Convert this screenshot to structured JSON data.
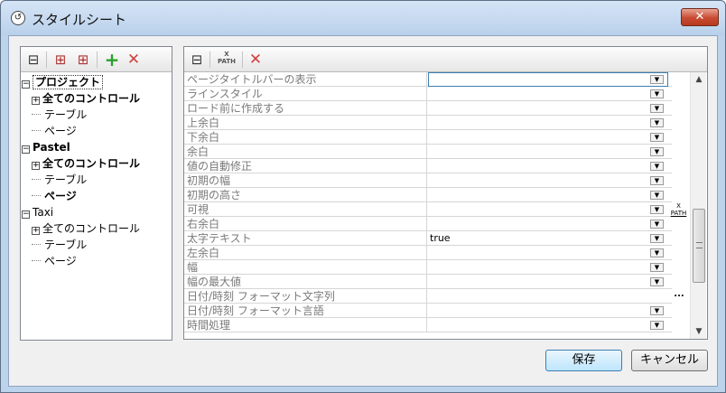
{
  "window": {
    "title": "スタイルシート",
    "close": "✕"
  },
  "left_toolbar": {
    "icons": [
      "tree-icon",
      "add-child-icon",
      "add-sibling-icon",
      "add-icon",
      "delete-icon"
    ],
    "glyphs": [
      "⊟",
      "⊞",
      "⊞",
      "+",
      "✕"
    ]
  },
  "tree": [
    {
      "label": "プロジェクト",
      "expander": "−",
      "bold": true,
      "level": 0,
      "selected": true
    },
    {
      "label": "全てのコントロール",
      "expander": "+",
      "bold": true,
      "level": 1
    },
    {
      "label": "テーブル",
      "level": 1
    },
    {
      "label": "ページ",
      "level": 1
    },
    {
      "label": "Pastel",
      "expander": "−",
      "bold": true,
      "level": 0
    },
    {
      "label": "全てのコントロール",
      "expander": "+",
      "bold": true,
      "level": 1
    },
    {
      "label": "テーブル",
      "level": 1
    },
    {
      "label": "ページ",
      "bold": true,
      "level": 1
    },
    {
      "label": "Taxi",
      "expander": "−",
      "level": 0
    },
    {
      "label": "全てのコントロール",
      "expander": "+",
      "level": 1
    },
    {
      "label": "テーブル",
      "level": 1
    },
    {
      "label": "ページ",
      "level": 1
    }
  ],
  "right_toolbar": {
    "tree_glyph": "⊟",
    "xpath_top": "X",
    "xpath_bottom": "PATH",
    "delete_glyph": "✕"
  },
  "properties": [
    {
      "name": "ページタイトルバーの表示",
      "value": "",
      "dropdown": true
    },
    {
      "name": "ラインスタイル",
      "value": "",
      "dropdown": true
    },
    {
      "name": "ロード前に作成する",
      "value": "",
      "dropdown": true
    },
    {
      "name": "上余白",
      "value": "",
      "dropdown": true
    },
    {
      "name": "下余白",
      "value": "",
      "dropdown": true
    },
    {
      "name": "余白",
      "value": "",
      "dropdown": true
    },
    {
      "name": "値の自動修正",
      "value": "",
      "dropdown": true
    },
    {
      "name": "初期の幅",
      "value": "",
      "dropdown": true
    },
    {
      "name": "初期の高さ",
      "value": "",
      "dropdown": true
    },
    {
      "name": "可視",
      "value": "",
      "dropdown": true,
      "xpath": true
    },
    {
      "name": "右余白",
      "value": "",
      "dropdown": true
    },
    {
      "name": "太字テキスト",
      "value": "true",
      "dropdown": true
    },
    {
      "name": "左余白",
      "value": "",
      "dropdown": true
    },
    {
      "name": "幅",
      "value": "",
      "dropdown": true
    },
    {
      "name": "幅の最大値",
      "value": "",
      "dropdown": true
    },
    {
      "name": "日付/時刻 フォーマット文字列",
      "value": "",
      "dropdown": false,
      "ellipsis": true
    },
    {
      "name": "日付/時刻 フォーマット言語",
      "value": "",
      "dropdown": true
    },
    {
      "name": "時間処理",
      "value": "",
      "dropdown": true
    }
  ],
  "scrollbar": {
    "up": "▲",
    "down": "▼"
  },
  "buttons": {
    "save": "保存",
    "cancel": "キャンセル"
  },
  "dropdown_glyph": "▼",
  "ellipsis_glyph": "...",
  "colors": {
    "title_bg": "#bcd3ec",
    "close_red": "#c74b31",
    "selection_border": "#3c7fb1"
  }
}
